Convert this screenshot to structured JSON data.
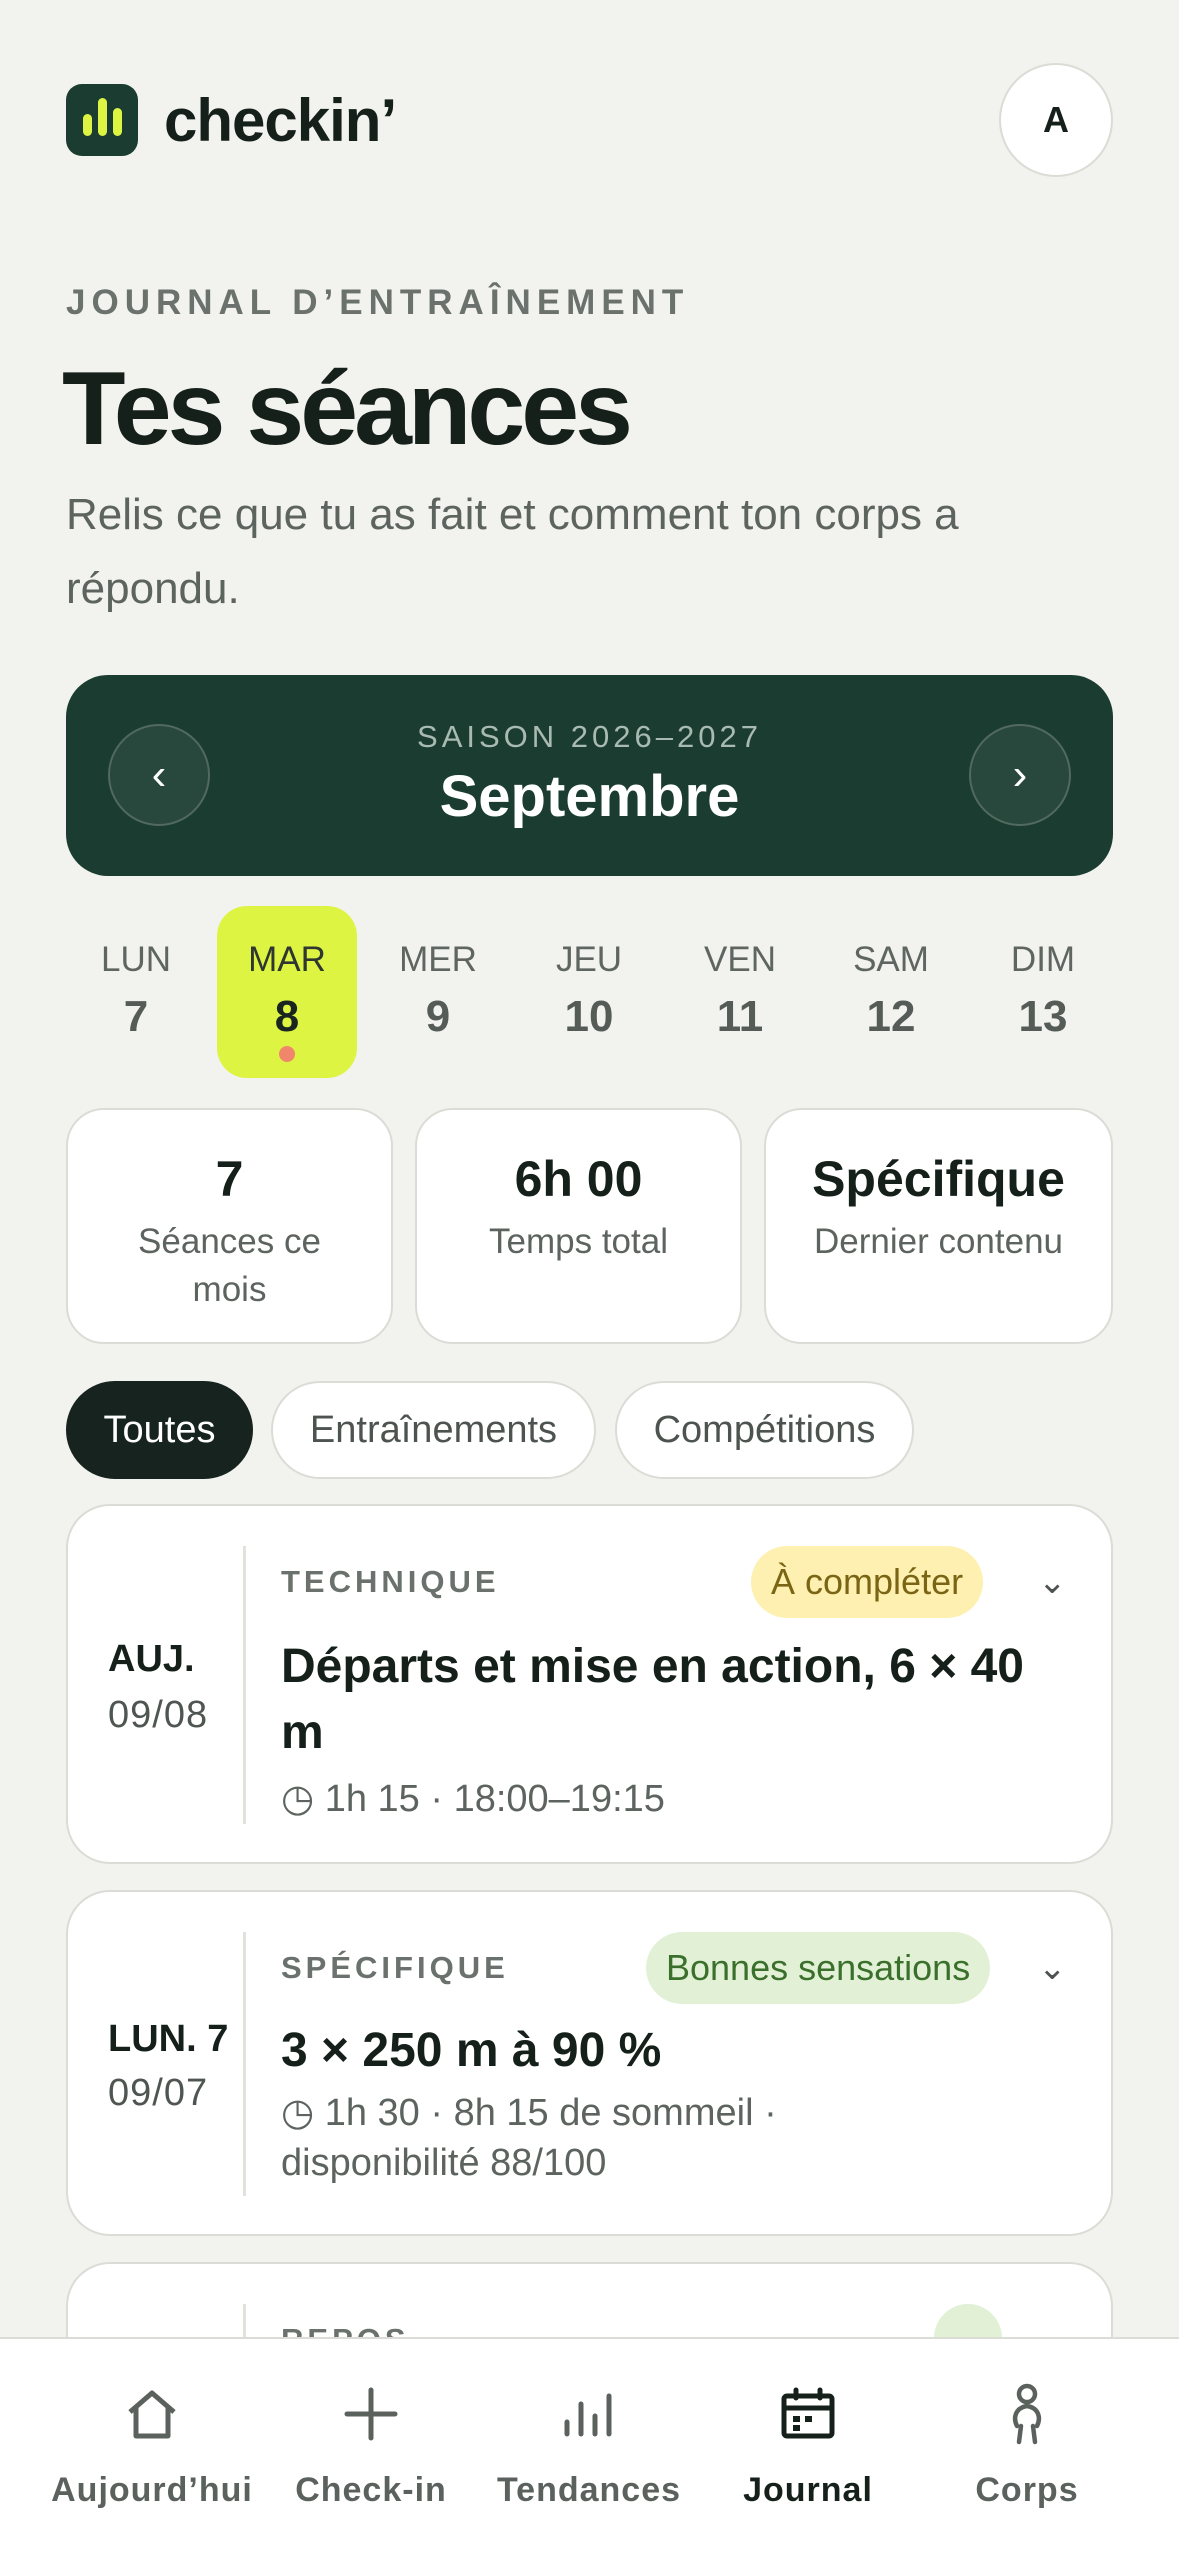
{
  "header": {
    "brand": "checkin’",
    "avatar_initial": "A"
  },
  "page": {
    "eyebrow": "JOURNAL D’ENTRAÎNEMENT",
    "title": "Tes séances",
    "subtitle": "Relis ce que tu as fait et comment ton corps a répondu."
  },
  "month_nav": {
    "season": "SAISON 2026–2027",
    "month": "Septembre",
    "prev_icon": "‹",
    "next_icon": "›"
  },
  "week": [
    {
      "name": "LUN",
      "num": "7"
    },
    {
      "name": "MAR",
      "num": "8",
      "selected": true
    },
    {
      "name": "MER",
      "num": "9"
    },
    {
      "name": "JEU",
      "num": "10"
    },
    {
      "name": "VEN",
      "num": "11"
    },
    {
      "name": "SAM",
      "num": "12"
    },
    {
      "name": "DIM",
      "num": "13"
    }
  ],
  "stats": [
    {
      "value": "7",
      "label": "Séances ce mois"
    },
    {
      "value": "6h 00",
      "label": "Temps total"
    },
    {
      "value": "Spécifique",
      "label": "Dernier contenu"
    }
  ],
  "filters": [
    "Toutes",
    "Entraînements",
    "Compétitions"
  ],
  "sessions": [
    {
      "date": "AUJ.",
      "date_sub": "09/08",
      "kind": "TECHNIQUE",
      "badge": "À compléter",
      "title": "Départs et mise en action, 6 × 40 m",
      "meta": "◷ 1h 15 · 18:00–19:15"
    },
    {
      "date": "LUN. 7",
      "date_sub": "09/07",
      "kind": "SPÉCIFIQUE",
      "badge": "Bonnes sensations",
      "title": "3 × 250 m à 90 %",
      "meta": "◷ 1h 30 · 8h 15 de sommeil · disponibilité 88/100"
    },
    {
      "kind": "REPOS"
    }
  ],
  "bottom_nav": [
    {
      "label": "Aujourd’hui",
      "icon": "home-icon"
    },
    {
      "label": "Check-in",
      "icon": "plus-icon"
    },
    {
      "label": "Tendances",
      "icon": "bar-chart-icon"
    },
    {
      "label": "Journal",
      "icon": "calendar-icon",
      "active": true
    },
    {
      "label": "Corps",
      "icon": "body-icon"
    }
  ],
  "colors": {
    "background": "#f2f2ee",
    "primary_dark": "#1b3d31",
    "accent_lime": "#ddf542",
    "dot_coral": "#f0876a",
    "badge_warn": "#fdf0b0",
    "badge_good": "#e2f1d6"
  }
}
